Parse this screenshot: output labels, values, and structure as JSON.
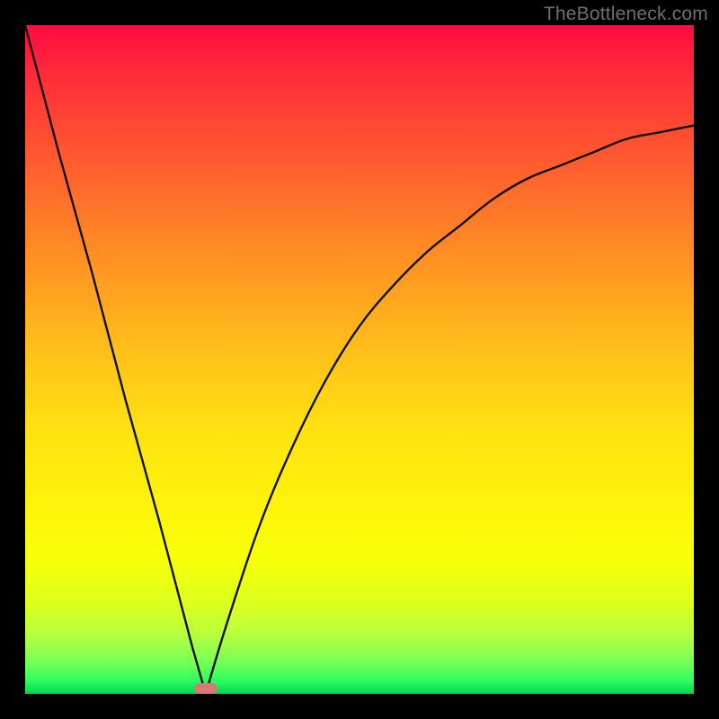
{
  "watermark": "TheBottleneck.com",
  "chart_data": {
    "type": "line",
    "title": "",
    "xlabel": "",
    "ylabel": "",
    "xlim": [
      0,
      100
    ],
    "ylim": [
      0,
      100
    ],
    "grid": false,
    "legend": false,
    "marker_x": 27,
    "series": [
      {
        "name": "left-descent",
        "x": [
          0,
          5,
          10,
          15,
          20,
          25,
          27
        ],
        "values": [
          100,
          81,
          63,
          44,
          26,
          7,
          0
        ]
      },
      {
        "name": "right-ascent",
        "x": [
          27,
          30,
          35,
          40,
          45,
          50,
          55,
          60,
          65,
          70,
          75,
          80,
          85,
          90,
          95,
          100
        ],
        "values": [
          0,
          10,
          25,
          37,
          47,
          55,
          61,
          66,
          70,
          74,
          77,
          79,
          81,
          83,
          84,
          85
        ]
      }
    ],
    "gradient": {
      "top": "#ff0b40",
      "bottom": "#00d455"
    }
  }
}
